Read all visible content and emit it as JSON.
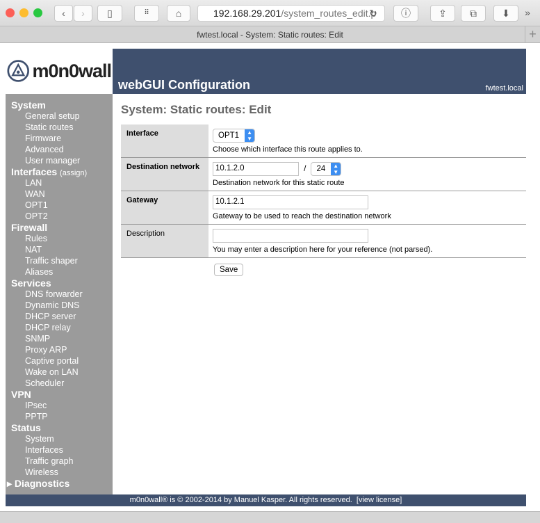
{
  "browser": {
    "url_host": "192.168.29.201",
    "url_path": "/system_routes_edit.p",
    "tab_title": "fwtest.local - System: Static routes: Edit"
  },
  "logo": {
    "text": "m0n0wall"
  },
  "header": {
    "title": "webGUI Configuration",
    "hostname": "fwtest.local"
  },
  "sidebar": [
    {
      "heading": "System",
      "items": [
        "General setup",
        "Static routes",
        "Firmware",
        "Advanced",
        "User manager"
      ]
    },
    {
      "heading": "Interfaces",
      "extra": "(assign)",
      "items": [
        "LAN",
        "WAN",
        "OPT1",
        "OPT2"
      ]
    },
    {
      "heading": "Firewall",
      "items": [
        "Rules",
        "NAT",
        "Traffic shaper",
        "Aliases"
      ]
    },
    {
      "heading": "Services",
      "items": [
        "DNS forwarder",
        "Dynamic DNS",
        "DHCP server",
        "DHCP relay",
        "SNMP",
        "Proxy ARP",
        "Captive portal",
        "Wake on LAN",
        "Scheduler"
      ]
    },
    {
      "heading": "VPN",
      "items": [
        "IPsec",
        "PPTP"
      ]
    },
    {
      "heading": "Status",
      "items": [
        "System",
        "Interfaces",
        "Traffic graph",
        "Wireless"
      ]
    },
    {
      "heading": "Diagnostics",
      "items": []
    }
  ],
  "main": {
    "title": "System: Static routes: Edit",
    "interface": {
      "label": "Interface",
      "value": "OPT1",
      "hint": "Choose which interface this route applies to."
    },
    "destination": {
      "label": "Destination network",
      "value": "10.1.2.0",
      "separator": "/",
      "mask": "24",
      "hint": "Destination network for this static route"
    },
    "gateway": {
      "label": "Gateway",
      "value": "10.1.2.1",
      "hint": "Gateway to be used to reach the destination network"
    },
    "description": {
      "label": "Description",
      "value": "",
      "hint": "You may enter a description here for your reference (not parsed)."
    },
    "save_label": "Save"
  },
  "footer": {
    "text": "m0n0wall® is © 2002-2014 by Manuel Kasper. All rights reserved.",
    "license_link": "[view license]"
  }
}
